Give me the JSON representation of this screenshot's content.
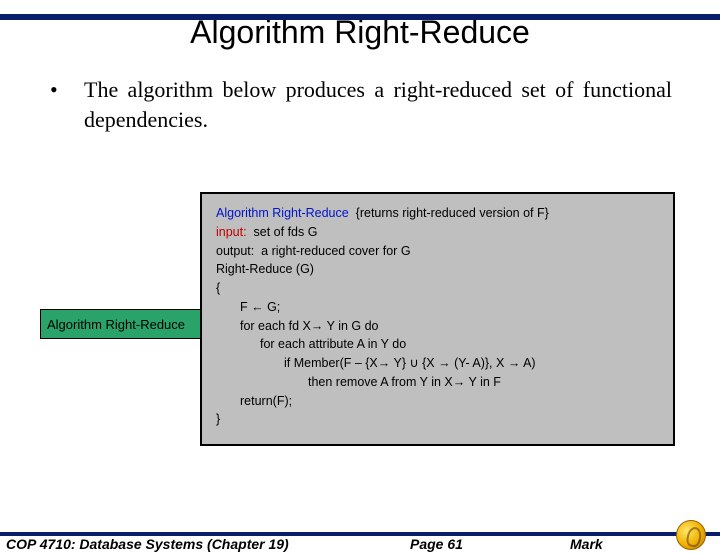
{
  "title": "Algorithm Right-Reduce",
  "bullet": {
    "marker": "•",
    "text": "The algorithm below produces a right-reduced set of functional dependencies."
  },
  "green_box_label": "Algorithm Right-Reduce",
  "algorithm": {
    "name": "Algorithm Right-Reduce",
    "comment": "  {returns right-reduced version of F}",
    "input_label": "input:",
    "input_text": "  set of fds G",
    "output_line": "output:  a right-reduced cover for G",
    "call_line": "Right-Reduce (G)",
    "open_brace": "{",
    "line1": "F ← G;",
    "line2": "for each fd X→ Y in G do",
    "line3": "for each attribute A in Y do",
    "line4": "if Member(F – {X→ Y} ∪ {X → (Y- A)}, X → A)",
    "line5": "then remove A from Y in X→ Y in F",
    "line6": "return(F);",
    "close_brace": "}"
  },
  "footer": {
    "course": "COP 4710: Database Systems  (Chapter 19)",
    "page": "Page 61",
    "author": "Mark"
  }
}
